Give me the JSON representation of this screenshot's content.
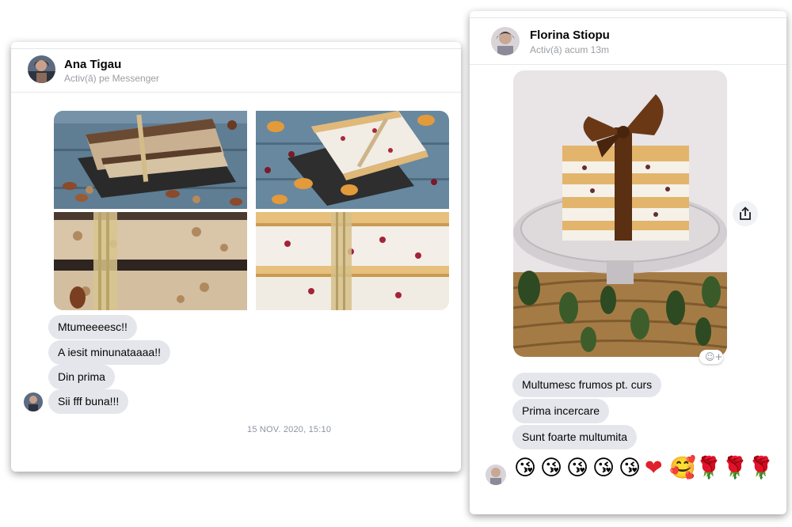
{
  "left_chat": {
    "contact_name": "Ana Tigau",
    "contact_status": "Activ(ă) pe Messenger",
    "messages": [
      "Mtumeeeesc!!",
      "A iesit minunataaaa!!",
      "Din prima",
      "Sii fff buna!!!"
    ],
    "timestamp": "15 NOV. 2020, 15:10"
  },
  "right_chat": {
    "contact_name": "Florina Stiopu",
    "contact_status": "Activ(ă) acum 13m",
    "messages": [
      "Multumesc frumos pt. curs",
      "Prima incercare",
      "Sunt foarte multumita"
    ],
    "emojis": [
      "😘",
      "😘",
      "😘",
      "😘",
      "😘",
      "❤",
      "🥰",
      "🌹",
      "🌹",
      "🌹"
    ]
  },
  "icons": {
    "share": "share-icon",
    "reaction": "add-reaction-icon"
  },
  "colors": {
    "bubble": "#e4e6eb",
    "ribbon": "#5a2f12",
    "table_blue": "#6c8da3"
  }
}
